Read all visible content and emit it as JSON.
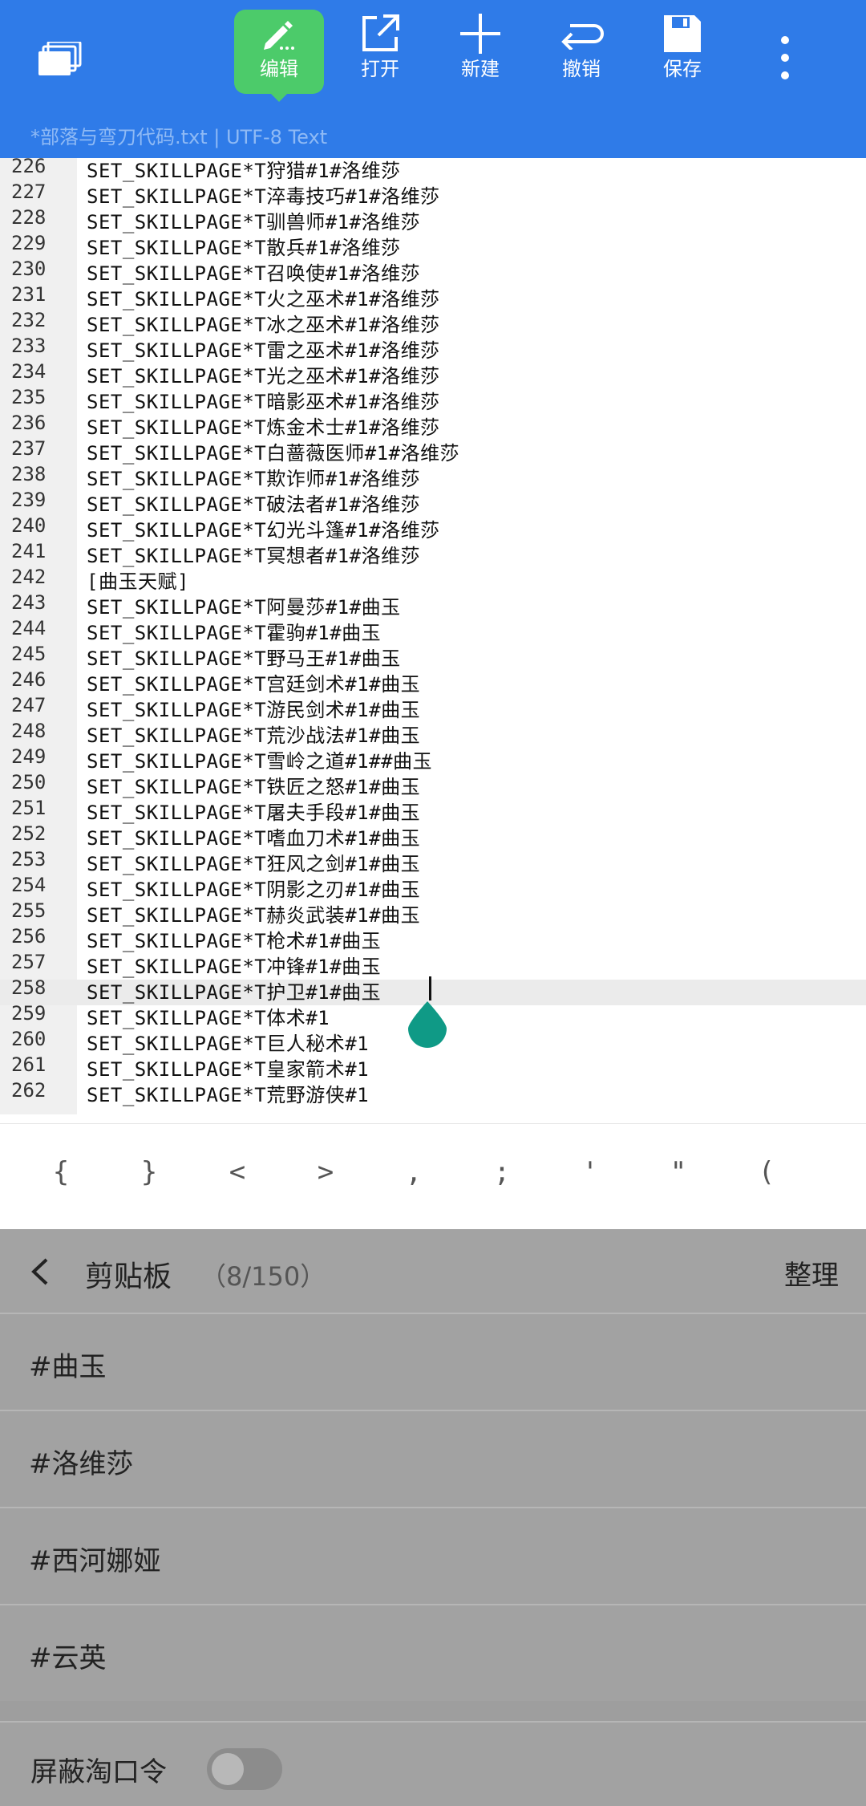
{
  "toolbar": {
    "buttons": [
      {
        "label": "编辑",
        "icon": "pencil-icon",
        "active": true
      },
      {
        "label": "打开",
        "icon": "open-external-icon"
      },
      {
        "label": "新建",
        "icon": "plus-icon"
      },
      {
        "label": "撤销",
        "icon": "undo-icon"
      },
      {
        "label": "保存",
        "icon": "save-icon"
      }
    ],
    "left_icon": "tabs-stack-icon",
    "more_icon": "more-vertical-icon",
    "colors": {
      "background": "#2f7be8",
      "active": "#4ccb6a"
    }
  },
  "file_info": "*部落与弯刀代码.txt  |  UTF-8   Text",
  "editor": {
    "current_line": "258",
    "lines": [
      {
        "n": "226",
        "text": "SET_SKILLPAGE*T狩猎#1#洛维莎"
      },
      {
        "n": "227",
        "text": "SET_SKILLPAGE*T淬毒技巧#1#洛维莎"
      },
      {
        "n": "228",
        "text": "SET_SKILLPAGE*T驯兽师#1#洛维莎"
      },
      {
        "n": "229",
        "text": "SET_SKILLPAGE*T散兵#1#洛维莎"
      },
      {
        "n": "230",
        "text": "SET_SKILLPAGE*T召唤使#1#洛维莎"
      },
      {
        "n": "231",
        "text": "SET_SKILLPAGE*T火之巫术#1#洛维莎"
      },
      {
        "n": "232",
        "text": "SET_SKILLPAGE*T冰之巫术#1#洛维莎"
      },
      {
        "n": "233",
        "text": "SET_SKILLPAGE*T雷之巫术#1#洛维莎"
      },
      {
        "n": "234",
        "text": "SET_SKILLPAGE*T光之巫术#1#洛维莎"
      },
      {
        "n": "235",
        "text": "SET_SKILLPAGE*T暗影巫术#1#洛维莎"
      },
      {
        "n": "236",
        "text": "SET_SKILLPAGE*T炼金术士#1#洛维莎"
      },
      {
        "n": "237",
        "text": "SET_SKILLPAGE*T白蔷薇医师#1#洛维莎"
      },
      {
        "n": "238",
        "text": "SET_SKILLPAGE*T欺诈师#1#洛维莎"
      },
      {
        "n": "239",
        "text": "SET_SKILLPAGE*T破法者#1#洛维莎"
      },
      {
        "n": "240",
        "text": "SET_SKILLPAGE*T幻光斗篷#1#洛维莎"
      },
      {
        "n": "241",
        "text": "SET_SKILLPAGE*T冥想者#1#洛维莎"
      },
      {
        "n": "242",
        "text": "[曲玉天赋]"
      },
      {
        "n": "243",
        "text": "SET_SKILLPAGE*T阿曼莎#1#曲玉"
      },
      {
        "n": "244",
        "text": "SET_SKILLPAGE*T霍驹#1#曲玉"
      },
      {
        "n": "245",
        "text": "SET_SKILLPAGE*T野马王#1#曲玉"
      },
      {
        "n": "246",
        "text": "SET_SKILLPAGE*T宫廷剑术#1#曲玉"
      },
      {
        "n": "247",
        "text": "SET_SKILLPAGE*T游民剑术#1#曲玉"
      },
      {
        "n": "248",
        "text": "SET_SKILLPAGE*T荒沙战法#1#曲玉"
      },
      {
        "n": "249",
        "text": "SET_SKILLPAGE*T雪岭之道#1##曲玉"
      },
      {
        "n": "250",
        "text": "SET_SKILLPAGE*T铁匠之怒#1#曲玉"
      },
      {
        "n": "251",
        "text": "SET_SKILLPAGE*T屠夫手段#1#曲玉"
      },
      {
        "n": "252",
        "text": "SET_SKILLPAGE*T嗜血刀术#1#曲玉"
      },
      {
        "n": "253",
        "text": "SET_SKILLPAGE*T狂风之剑#1#曲玉"
      },
      {
        "n": "254",
        "text": "SET_SKILLPAGE*T阴影之刃#1#曲玉"
      },
      {
        "n": "255",
        "text": "SET_SKILLPAGE*T赫炎武装#1#曲玉"
      },
      {
        "n": "256",
        "text": "SET_SKILLPAGE*T枪术#1#曲玉"
      },
      {
        "n": "257",
        "text": "SET_SKILLPAGE*T冲锋#1#曲玉"
      },
      {
        "n": "258",
        "text": "SET_SKILLPAGE*T护卫#1#曲玉"
      },
      {
        "n": "259",
        "text": "SET_SKILLPAGE*T体术#1"
      },
      {
        "n": "260",
        "text": "SET_SKILLPAGE*T巨人秘术#1"
      },
      {
        "n": "261",
        "text": "SET_SKILLPAGE*T皇家箭术#1"
      },
      {
        "n": "262",
        "text": "SET_SKILLPAGE*T荒野游侠#1"
      }
    ],
    "cursor_handle_color": "#0f9a86"
  },
  "symbols": [
    "{",
    "}",
    "<",
    ">",
    ",",
    ";",
    "'",
    "\"",
    "("
  ],
  "clipboard": {
    "title": "剪贴板",
    "count": "（8/150）",
    "tidy_label": "整理",
    "items": [
      "#曲玉",
      "#洛维莎",
      "#西河娜娅",
      "#云英"
    ],
    "toggle_label": "屏蔽淘口令",
    "toggle_on": false
  }
}
